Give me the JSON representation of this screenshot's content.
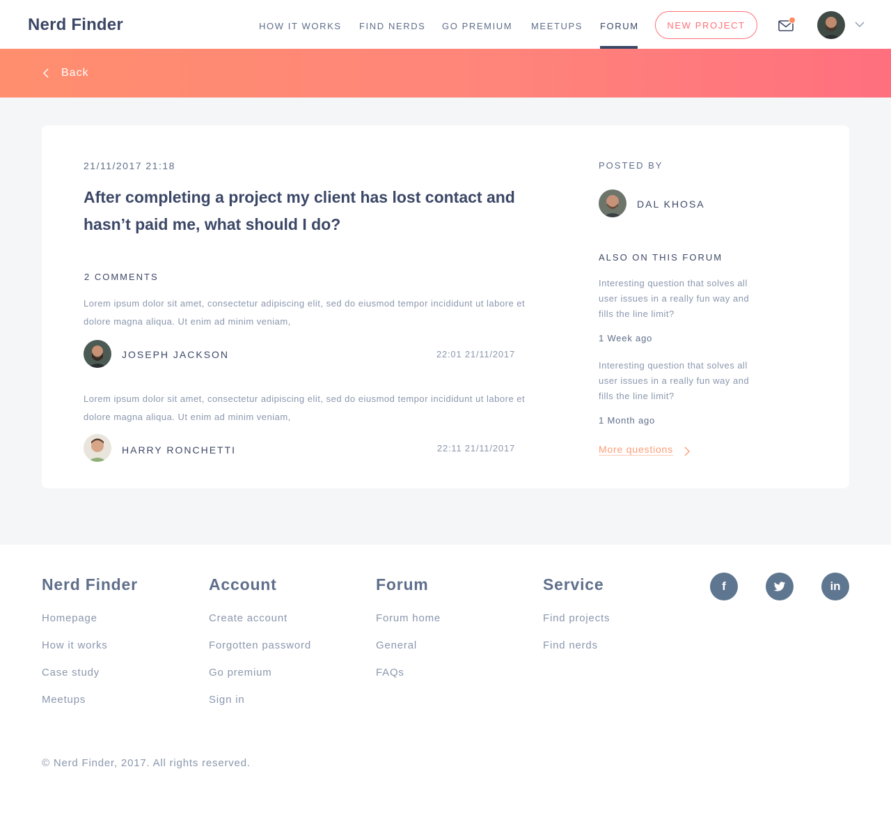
{
  "header": {
    "brand": "Nerd Finder",
    "nav": [
      "HOW IT WORKS",
      "FIND NERDS",
      "GO PREMIUM",
      "MEETUPS",
      "FORUM"
    ],
    "new_project_label": "NEW PROJECT",
    "icons": {
      "mail": "mail-icon",
      "notification": "notification-dot",
      "dropdown": "chevron-down-icon"
    }
  },
  "banner": {
    "back_label": "Back"
  },
  "post": {
    "date": "21/11/2017 21:18",
    "title": "After completing a project my client has lost contact and hasn’t paid me, what should I do?",
    "comments_label": "2 COMMENTS",
    "comments": [
      {
        "text": "Lorem ipsum dolor sit amet, consectetur adipiscing elit, sed do eiusmod tempor incididunt ut labore et dolore magna aliqua. Ut enim ad minim veniam,",
        "author": "JOSEPH JACKSON",
        "time": "22:01 21/11/2017"
      },
      {
        "text": "Lorem ipsum dolor sit amet, consectetur adipiscing elit, sed do eiusmod tempor incididunt ut labore et dolore magna aliqua. Ut enim ad minim veniam,",
        "author": "HARRY RONCHETTI",
        "time": "22:11 21/11/2017"
      }
    ]
  },
  "sidebar": {
    "posted_by_label": "POSTED BY",
    "poster_name": "DAL KHOSA",
    "also_label": "ALSO ON THIS FORUM",
    "related": [
      {
        "question": "Interesting question that solves all user issues in a really fun way and fills the line limit?",
        "age": "1 Week ago"
      },
      {
        "question": "Interesting question that solves all user issues in a really fun way and fills the line limit?",
        "age": "1 Month ago"
      }
    ],
    "more_label": "More questions"
  },
  "footer": {
    "columns": [
      {
        "title": "Nerd Finder",
        "links": [
          "Homepage",
          "How it works",
          "Case study",
          "Meetups"
        ]
      },
      {
        "title": "Account",
        "links": [
          "Create account",
          "Forgotten password",
          "Go premium",
          "Sign in"
        ]
      },
      {
        "title": "Forum",
        "links": [
          "Forum home",
          "General",
          "FAQs"
        ]
      },
      {
        "title": "Service",
        "links": [
          "Find projects",
          "Find nerds"
        ]
      }
    ],
    "social": [
      {
        "name": "facebook-icon",
        "glyph": "f"
      },
      {
        "name": "twitter-icon",
        "glyph": "t"
      },
      {
        "name": "linkedin-icon",
        "glyph": "in"
      }
    ],
    "copyright": "© Nerd Finder, 2017. All rights reserved."
  },
  "colors": {
    "accent": "#ff6f76",
    "banner_start": "#ff8e6e",
    "banner_end": "#ff6f7e",
    "text_dark": "#3b4766",
    "text_muted": "#8a97ad",
    "social_bg": "#5f7690"
  }
}
